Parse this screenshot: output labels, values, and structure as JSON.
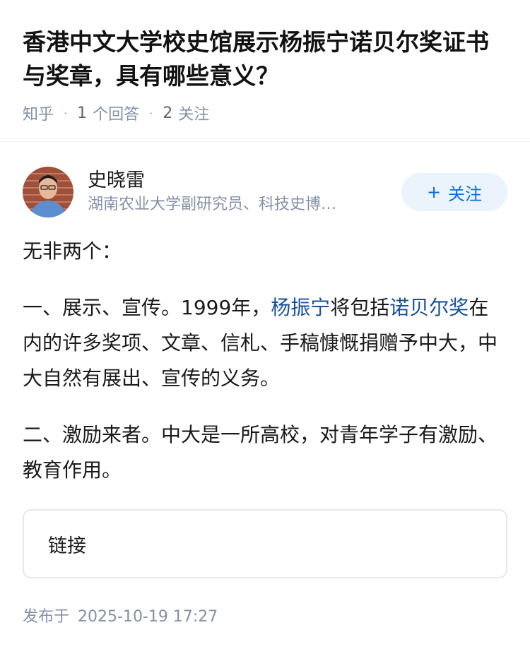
{
  "question": {
    "title": "香港中文大学校史馆展示杨振宁诺贝尔奖证书与奖章，具有哪些意义？",
    "source": "知乎",
    "answer_count": "1",
    "answer_label": "个回答",
    "follow_count": "2",
    "follow_label": "关注"
  },
  "author": {
    "name": "史晓雷",
    "description": "湖南农业大学副研究员、科技史博…",
    "follow_button": "关注"
  },
  "answer": {
    "p1": "无非两个：",
    "p2_before": "一、展示、宣传。1999年，",
    "p2_link1": "杨振宁",
    "p2_middle": "将包括",
    "p2_link2": "诺贝尔奖",
    "p2_after": "在内的许多奖项、文章、信札、手稿慷慨捐赠予中大，中大自然有展出、宣传的义务。",
    "p3": "二、激励来者。中大是一所高校，对青年学子有激励、教育作用。",
    "link_card": "链接"
  },
  "footer": {
    "published_label": "发布于",
    "published_time": "2025-10-19 17:27"
  },
  "colors": {
    "link": "#175199",
    "follow_button_bg": "#ebf3fc",
    "follow_button_text": "#056de8",
    "meta_gray": "#8590a6"
  }
}
